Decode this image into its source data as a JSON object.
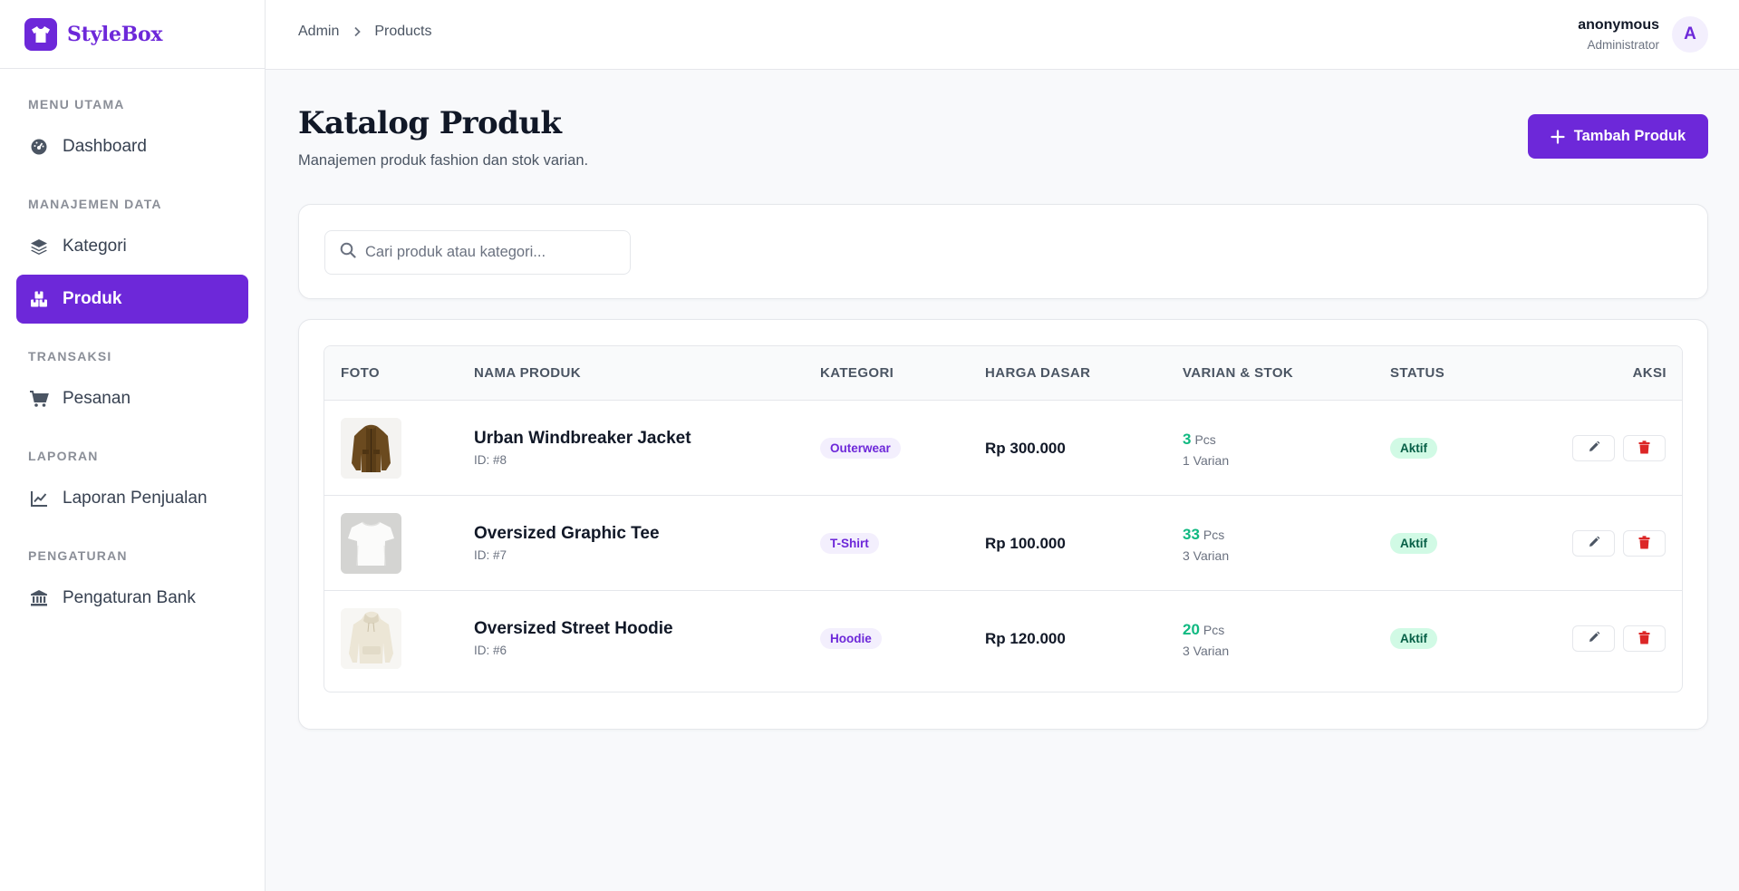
{
  "brand": {
    "name": "StyleBox",
    "accent": "#6d28d9"
  },
  "sidebar": {
    "sections": [
      {
        "title": "MENU UTAMA",
        "items": [
          {
            "label": "Dashboard",
            "icon": "gauge-icon"
          }
        ]
      },
      {
        "title": "MANAJEMEN DATA",
        "items": [
          {
            "label": "Kategori",
            "icon": "layers-icon"
          },
          {
            "label": "Produk",
            "icon": "boxes-icon",
            "active": true
          }
        ]
      },
      {
        "title": "TRANSAKSI",
        "items": [
          {
            "label": "Pesanan",
            "icon": "cart-icon"
          }
        ]
      },
      {
        "title": "LAPORAN",
        "items": [
          {
            "label": "Laporan Penjualan",
            "icon": "chart-line-icon"
          }
        ]
      },
      {
        "title": "PENGATURAN",
        "items": [
          {
            "label": "Pengaturan Bank",
            "icon": "bank-icon"
          }
        ]
      }
    ]
  },
  "topbar": {
    "breadcrumb": [
      "Admin",
      "Products"
    ],
    "user": {
      "name": "anonymous",
      "role": "Administrator",
      "initial": "A"
    }
  },
  "main": {
    "title": "Katalog Produk",
    "subtitle": "Manajemen produk fashion dan stok varian.",
    "add_label": "Tambah Produk",
    "search_placeholder": "Cari produk atau kategori..."
  },
  "table": {
    "headers": [
      "FOTO",
      "NAMA PRODUK",
      "KATEGORI",
      "HARGA DASAR",
      "VARIAN & STOK",
      "STATUS",
      "AKSI"
    ],
    "rows": [
      {
        "name": "Urban Windbreaker Jacket",
        "id": "ID: #8",
        "category": "Outerwear",
        "price": "Rp 300.000",
        "stock": "3",
        "unit": "Pcs",
        "variants": "1 Varian",
        "status": "Aktif",
        "photo": "jacket"
      },
      {
        "name": "Oversized Graphic Tee",
        "id": "ID: #7",
        "category": "T-Shirt",
        "price": "Rp 100.000",
        "stock": "33",
        "unit": "Pcs",
        "variants": "3 Varian",
        "status": "Aktif",
        "photo": "tshirt"
      },
      {
        "name": "Oversized Street Hoodie",
        "id": "ID: #6",
        "category": "Hoodie",
        "price": "Rp 120.000",
        "stock": "20",
        "unit": "Pcs",
        "variants": "3 Varian",
        "status": "Aktif",
        "photo": "hoodie"
      }
    ]
  },
  "colors": {
    "accent": "#6d28d9",
    "stock": "#10b981",
    "status_bg": "#d1fae5",
    "delete": "#dc2626"
  }
}
